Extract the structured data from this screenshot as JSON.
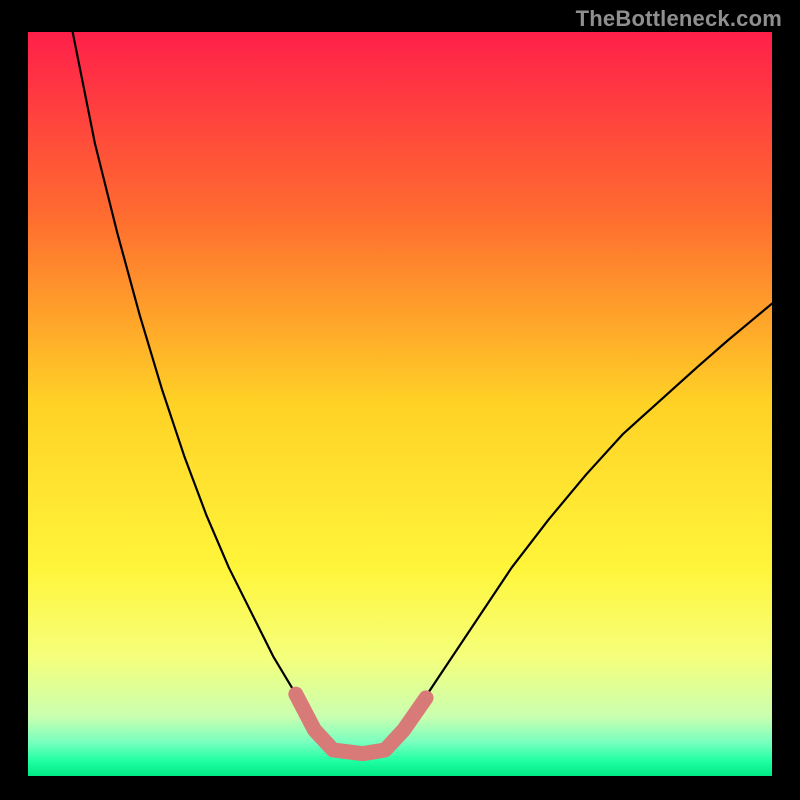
{
  "watermark": {
    "text": "TheBottleneck.com"
  },
  "chart_data": {
    "type": "line",
    "title": "",
    "xlabel": "",
    "ylabel": "",
    "x_range": [
      0,
      1
    ],
    "y_range": [
      0,
      1
    ],
    "series": [
      {
        "name": "left-branch",
        "x": [
          0.06,
          0.09,
          0.12,
          0.15,
          0.18,
          0.21,
          0.24,
          0.27,
          0.3,
          0.33,
          0.36,
          0.385
        ],
        "y": [
          1.0,
          0.85,
          0.73,
          0.62,
          0.52,
          0.43,
          0.35,
          0.28,
          0.22,
          0.16,
          0.11,
          0.062
        ]
      },
      {
        "name": "valley-floor",
        "x": [
          0.385,
          0.41,
          0.45,
          0.48,
          0.505
        ],
        "y": [
          0.062,
          0.035,
          0.03,
          0.035,
          0.062
        ]
      },
      {
        "name": "right-branch",
        "x": [
          0.505,
          0.55,
          0.6,
          0.65,
          0.7,
          0.75,
          0.8,
          0.85,
          0.9,
          0.94,
          0.97,
          1.0
        ],
        "y": [
          0.062,
          0.13,
          0.205,
          0.28,
          0.345,
          0.405,
          0.46,
          0.505,
          0.55,
          0.585,
          0.61,
          0.635
        ]
      }
    ],
    "highlight": {
      "name": "marker-band",
      "color": "#d87a78",
      "x": [
        0.36,
        0.385,
        0.41,
        0.45,
        0.48,
        0.505,
        0.535
      ],
      "y": [
        0.11,
        0.062,
        0.035,
        0.03,
        0.035,
        0.062,
        0.105
      ]
    },
    "background": {
      "type": "vertical-gradient",
      "stops": [
        {
          "offset": 0.0,
          "color": "#ff1f4a"
        },
        {
          "offset": 0.25,
          "color": "#ff6d2f"
        },
        {
          "offset": 0.5,
          "color": "#ffd226"
        },
        {
          "offset": 0.72,
          "color": "#fff53a"
        },
        {
          "offset": 0.84,
          "color": "#f5ff7b"
        },
        {
          "offset": 0.92,
          "color": "#caffb0"
        },
        {
          "offset": 0.955,
          "color": "#77ffbf"
        },
        {
          "offset": 0.98,
          "color": "#1fffa3"
        },
        {
          "offset": 1.0,
          "color": "#00e886"
        }
      ]
    },
    "grid": false,
    "legend": false
  }
}
